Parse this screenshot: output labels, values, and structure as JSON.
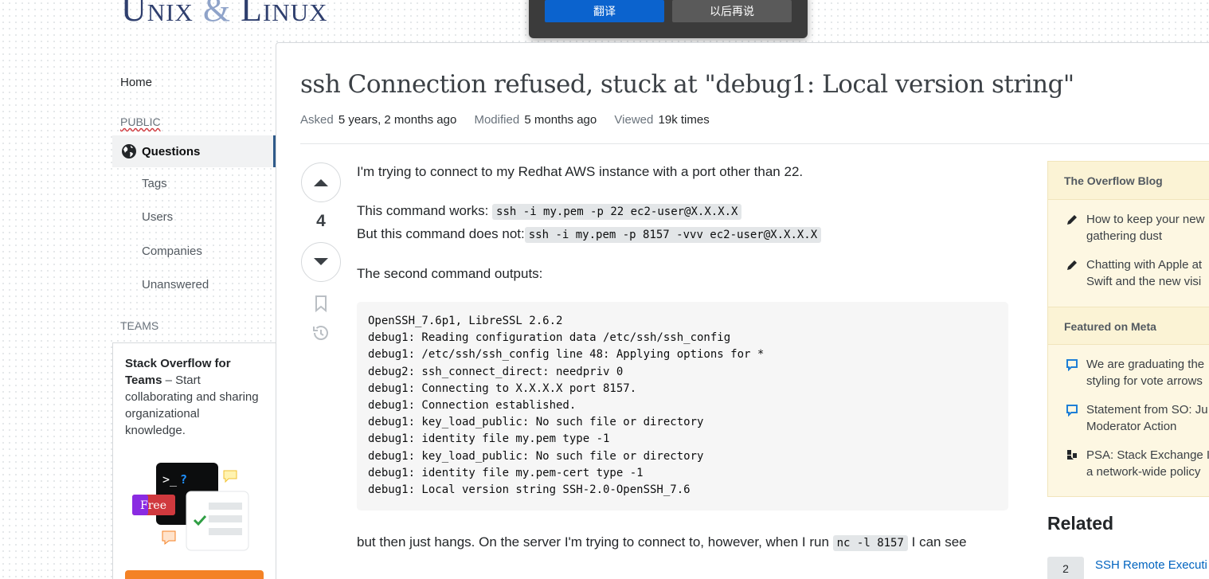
{
  "site": {
    "logo": "Unix",
    "logo_amp": "&",
    "logo2": "Linux"
  },
  "translate_popup": {
    "translate": "翻译",
    "later": "以后再说"
  },
  "nav": {
    "home": "Home",
    "public": "PUBLIC",
    "questions": "Questions",
    "items": [
      "Tags",
      "Users",
      "Companies",
      "Unanswered"
    ],
    "teams": "TEAMS",
    "teams_box": {
      "title": "Stack Overflow for Teams",
      "text": " – Start collaborating and sharing organizational knowledge.",
      "badge": "Free"
    }
  },
  "question": {
    "title": "ssh Connection refused, stuck at \"debug1: Local version string\"",
    "asked_label": "Asked",
    "asked": "5 years, 2 months ago",
    "modified_label": "Modified",
    "modified": "5 months ago",
    "viewed_label": "Viewed",
    "viewed": "19k times",
    "votes": "4",
    "body": {
      "p1": "I'm trying to connect to my Redhat AWS instance with a port other than 22.",
      "works_text": "This command works: ",
      "works_code": "ssh -i my.pem -p 22 ec2-user@X.X.X.X",
      "notworks_text": "But this command does not:",
      "notworks_code": "ssh -i my.pem -p 8157 -vvv ec2-user@X.X.X.X",
      "p3": "The second command outputs:",
      "output_lines": [
        "OpenSSH_7.6p1, LibreSSL 2.6.2",
        "debug1: Reading configuration data /etc/ssh/ssh_config",
        "debug1: /etc/ssh/ssh_config line 48: Applying options for *",
        "debug2: ssh_connect_direct: needpriv 0",
        "debug1: Connecting to X.X.X.X port 8157.",
        "debug1: Connection established.",
        "debug1: key_load_public: No such file or directory",
        "debug1: identity file my.pem type -1",
        "debug1: key_load_public: No such file or directory",
        "debug1: identity file my.pem-cert type -1",
        "debug1: Local version string SSH-2.0-OpenSSH_7.6"
      ],
      "p4_pre": "but then just hangs. On the server I'm trying to connect to, however, when I run ",
      "p4_code": "nc -l 8157",
      "p4_post": " I can see"
    }
  },
  "sidebar": {
    "blog_title": "The Overflow Blog",
    "blog_items": [
      "How to keep your new",
      "gathering dust",
      "Chatting with Apple at",
      "Swift and the new visi"
    ],
    "meta_title": "Featured on Meta",
    "meta_items": [
      "We are graduating the",
      "styling for vote arrows",
      "Statement from SO: Ju",
      "Moderator Action",
      "PSA: Stack Exchange I",
      "a network-wide policy"
    ],
    "related_title": "Related",
    "related": [
      {
        "count": "2",
        "title": "SSH Remote Executi"
      }
    ]
  }
}
